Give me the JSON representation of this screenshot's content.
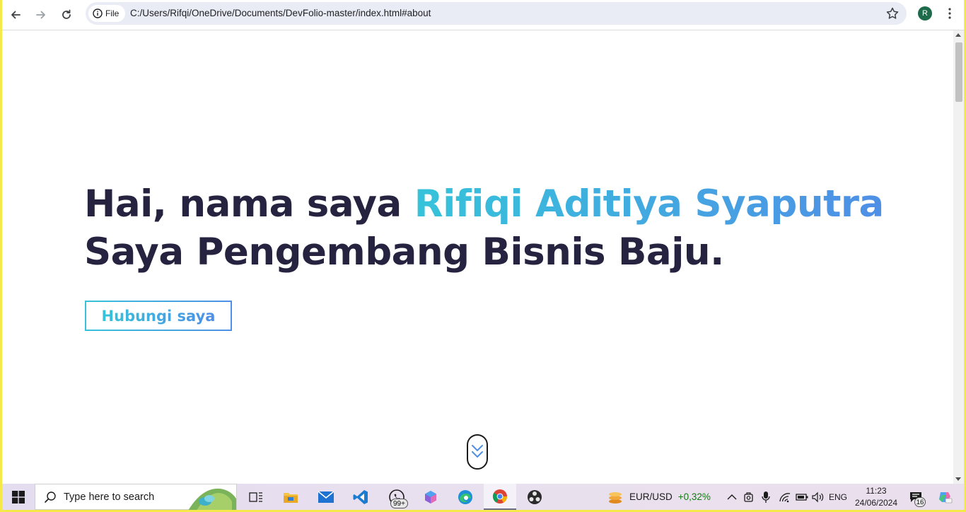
{
  "browser": {
    "site_chip_label": "File",
    "url": "C:/Users/Rifqi/OneDrive/Documents/DevFolio-master/index.html#about",
    "profile_initial": "R"
  },
  "hero": {
    "greeting": "Hai, nama saya ",
    "name": "Rifiqi Aditiya Syaputra",
    "tagline": "Saya Pengembang Bisnis Baju.",
    "cta_label": "Hubungi saya"
  },
  "taskbar": {
    "search_placeholder": "Type here to search",
    "whatsapp_badge": "99+",
    "ticker_pair": "EUR/USD",
    "ticker_change": "+0,32%",
    "language": "ENG",
    "time": "11:23",
    "date": "24/06/2024",
    "notification_count": "16"
  },
  "colors": {
    "heading": "#25233f",
    "accent_start": "#36c3da",
    "accent_end": "#4f8fe6",
    "ticker_positive": "#107c10"
  }
}
